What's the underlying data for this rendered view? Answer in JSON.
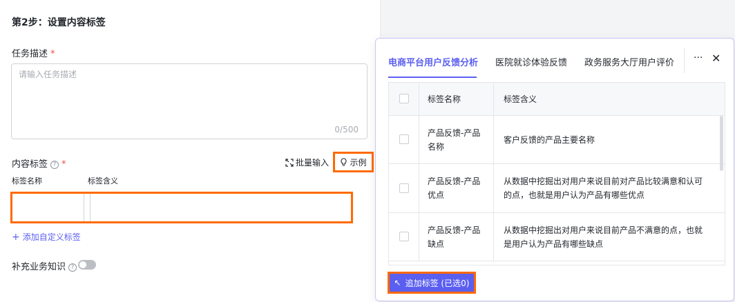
{
  "form": {
    "step_title": "第2步：设置内容标签",
    "task_desc_label": "任务描述",
    "required_mark": "*",
    "task_desc_placeholder": "请输入任务描述",
    "task_desc_count": "0/500",
    "content_tags_label": "内容标签",
    "batch_input_label": "批量输入",
    "example_label": "示例",
    "col_tag_name": "标签名称",
    "col_tag_meaning": "标签含义",
    "add_custom_tag": "添加自定义标签",
    "supplement_label": "补充业务知识",
    "supplement_enabled": false
  },
  "popover": {
    "tabs": [
      {
        "label": "电商平台用户反馈分析",
        "active": true
      },
      {
        "label": "医院就诊体验反馈",
        "active": false
      },
      {
        "label": "政务服务大厅用户评价",
        "active": false
      }
    ],
    "more_label": "···",
    "close_label": "✕",
    "table": {
      "headers": [
        "标签名称",
        "标签含义"
      ],
      "rows": [
        {
          "name": "产品反馈-产品名称",
          "meaning": "客户反馈的产品主要名称"
        },
        {
          "name": "产品反馈-产品优点",
          "meaning": "从数据中挖掘出对用户来说目前对产品比较满意和认可的点，也就是用户认为产品有哪些优点"
        },
        {
          "name": "产品反馈-产品缺点",
          "meaning": "从数据中挖掘出对用户来说目前产品不满意的点，也就是用户认为产品有哪些缺点"
        }
      ]
    },
    "add_button_label": "追加标签 (已选0)",
    "accent_color": "#5b5ff0",
    "highlight_color": "#ff6a00"
  }
}
